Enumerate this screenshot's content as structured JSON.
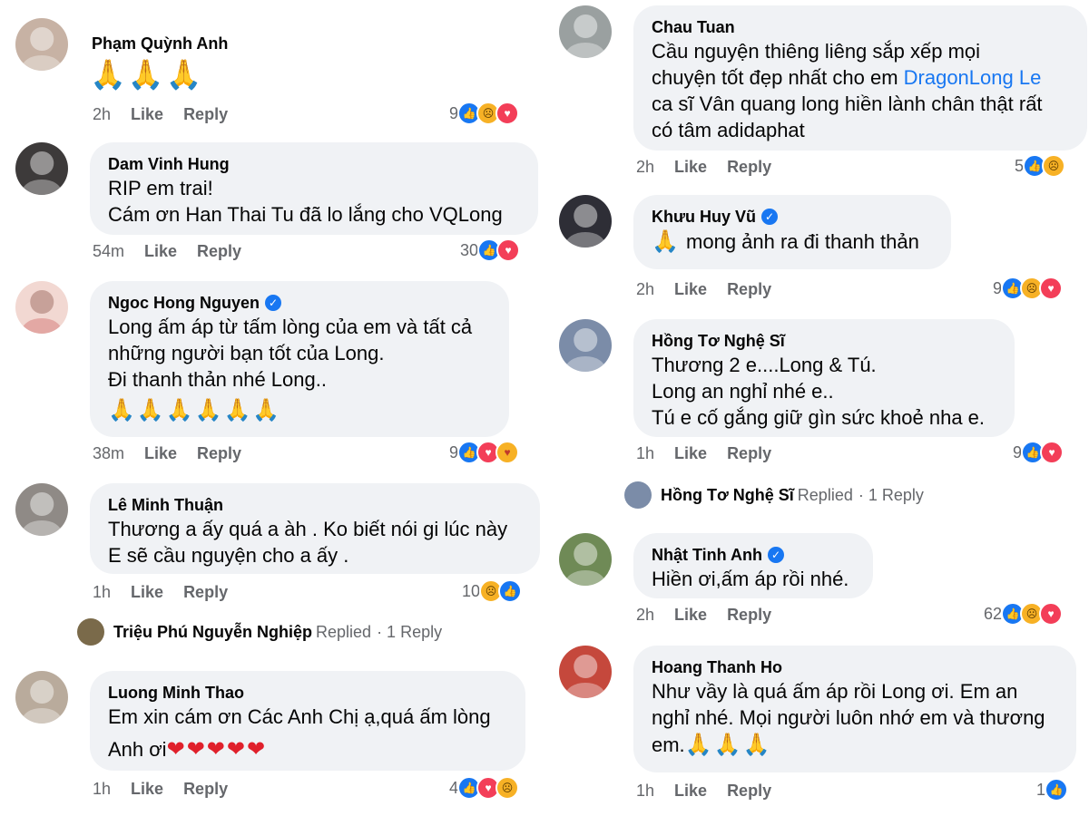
{
  "left_comments": [
    {
      "name": "Phạm Quỳnh Anh",
      "verified": false,
      "lines": [],
      "emoji": "🙏🙏🙏",
      "time": "2h",
      "like": "Like",
      "reply": "Reply",
      "reaction_count": "9",
      "reactions": [
        "like",
        "sad",
        "love"
      ],
      "avatar_color": "#c7b2a4"
    },
    {
      "name": "Dam Vinh Hung",
      "verified": false,
      "lines": [
        "RIP em trai!",
        "Cám ơn Han Thai Tu đã lo lắng cho VQLong"
      ],
      "time": "54m",
      "like": "Like",
      "reply": "Reply",
      "reaction_count": "30",
      "reactions": [
        "like",
        "love"
      ],
      "avatar_color": "#3d3a3a"
    },
    {
      "name": "Ngoc Hong Nguyen",
      "verified": true,
      "lines": [
        "Long ấm áp từ tấm lòng của em và tất cả",
        "những người bạn tốt của Long.",
        "Đi thanh thản nhé Long.."
      ],
      "emoji": "🙏🙏🙏🙏🙏🙏",
      "time": "38m",
      "like": "Like",
      "reply": "Reply",
      "reaction_count": "9",
      "reactions": [
        "like",
        "love",
        "care"
      ],
      "avatar_color": "#f2d8d2"
    },
    {
      "name": "Lê Minh Thuận",
      "verified": false,
      "lines": [
        "Thương a ấy quá a àh . Ko biết nói gi lúc này",
        "E sẽ cầu nguyện cho a ấy ."
      ],
      "time": "1h",
      "like": "Like",
      "reply": "Reply",
      "reaction_count": "10",
      "reactions": [
        "sad",
        "like"
      ],
      "avatar_color": "#8f8a86",
      "replied": {
        "name": "Triệu Phú Nguyễn Nghiệp",
        "action": "Replied",
        "count": "· 1 Reply"
      }
    },
    {
      "name": "Luong Minh Thao",
      "verified": false,
      "lines": [
        "Em xin cám ơn Các Anh Chị ạ,quá ấm lòng"
      ],
      "lastline_text": "Anh ơi",
      "lastline_hearts": "❤❤❤❤❤",
      "time": "1h",
      "like": "Like",
      "reply": "Reply",
      "reaction_count": "4",
      "reactions": [
        "like",
        "love",
        "sad"
      ],
      "avatar_color": "#b9ab9c"
    }
  ],
  "right_comments": [
    {
      "name": "Chau Tuan",
      "verified": false,
      "line1": "Cầu nguyện thiêng liêng sắp xếp mọi",
      "line2_pre": "chuyện tốt đẹp nhất cho em ",
      "line2_mention": "DragonLong Le",
      "line3": "ca sĩ Vân quang long  hiền lành chân thật rất",
      "line4": "có tâm adidaphat",
      "time": "2h",
      "like": "Like",
      "reply": "Reply",
      "reaction_count": "5",
      "reactions": [
        "like",
        "sad"
      ],
      "avatar_color": "#9aa0a0"
    },
    {
      "name": "Khưu Huy Vũ",
      "verified": true,
      "emoji_prefix": "🙏",
      "lines": [
        "mong ảnh ra đi thanh thản"
      ],
      "time": "2h",
      "like": "Like",
      "reply": "Reply",
      "reaction_count": "9",
      "reactions": [
        "like",
        "sad",
        "love"
      ],
      "avatar_color": "#2e2e36"
    },
    {
      "name": "Hồng Tơ Nghệ Sĩ",
      "verified": false,
      "lines": [
        "Thương 2 e....Long & Tú.",
        "Long an nghỉ nhé e..",
        "Tú e cố gắng giữ gìn sức khoẻ nha e."
      ],
      "time": "1h",
      "like": "Like",
      "reply": "Reply",
      "reaction_count": "9",
      "reactions": [
        "like",
        "love"
      ],
      "avatar_color": "#7b8ca8",
      "replied": {
        "name": "Hồng Tơ Nghệ Sĩ",
        "action": "Replied",
        "count": "· 1 Reply"
      }
    },
    {
      "name": "Nhật Tinh Anh",
      "verified": true,
      "lines": [
        "Hiền ơi,ấm áp rồi nhé."
      ],
      "time": "2h",
      "like": "Like",
      "reply": "Reply",
      "reaction_count": "62",
      "reactions": [
        "like",
        "sad",
        "love"
      ],
      "avatar_color": "#6f8a56"
    },
    {
      "name": "Hoang Thanh Ho",
      "verified": false,
      "lines": [
        "Như vầy là quá ấm áp rồi Long ơi. Em an",
        "nghỉ nhé. Mọi người luôn nhớ em và thương"
      ],
      "lastline_text": "em.",
      "lastline_emoji": "🙏🙏🙏",
      "time": "1h",
      "like": "Like",
      "reply": "Reply",
      "reaction_count": "1",
      "reactions": [
        "like"
      ],
      "avatar_color": "#c5483c"
    }
  ],
  "colors": {
    "bubble": "#f0f2f5",
    "link": "#1877f2",
    "meta": "#65676b"
  }
}
